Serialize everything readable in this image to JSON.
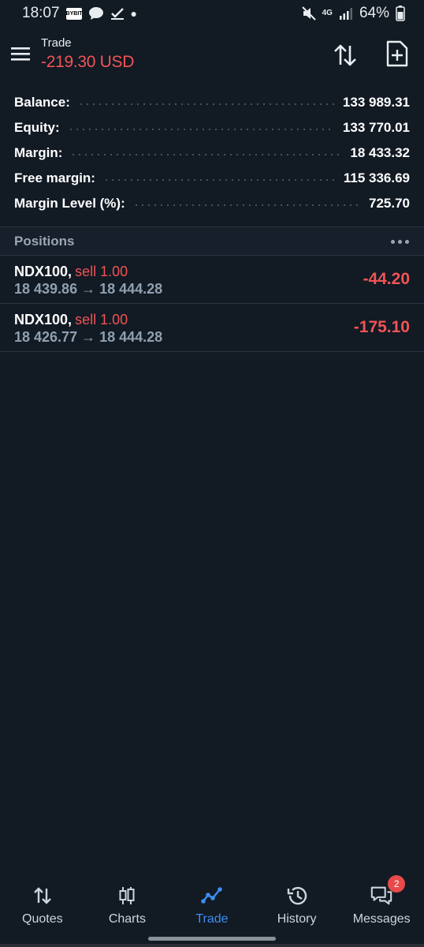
{
  "status_bar": {
    "time": "18:07",
    "notif_badge": "BYBIT",
    "network": "4G",
    "battery": "64%"
  },
  "header": {
    "title": "Trade",
    "pnl": "-219.30 USD"
  },
  "summary": [
    {
      "label": "Balance:",
      "value": "133 989.31"
    },
    {
      "label": "Equity:",
      "value": "133 770.01"
    },
    {
      "label": "Margin:",
      "value": "18 433.32"
    },
    {
      "label": "Free margin:",
      "value": "115 336.69"
    },
    {
      "label": "Margin Level (%):",
      "value": "725.70"
    }
  ],
  "positions": {
    "title": "Positions",
    "items": [
      {
        "symbol": "NDX100",
        "side": "sell 1.00",
        "prices": "18 439.86 → 18 444.28",
        "profit": "-44.20"
      },
      {
        "symbol": "NDX100",
        "side": "sell 1.00",
        "prices": "18 426.77 → 18 444.28",
        "profit": "-175.10"
      }
    ]
  },
  "nav": {
    "quotes": "Quotes",
    "charts": "Charts",
    "trade": "Trade",
    "history": "History",
    "messages": "Messages",
    "messages_badge": "2"
  },
  "colors": {
    "background": "#121a24",
    "loss": "#f05454",
    "accent": "#3d8ef0"
  }
}
